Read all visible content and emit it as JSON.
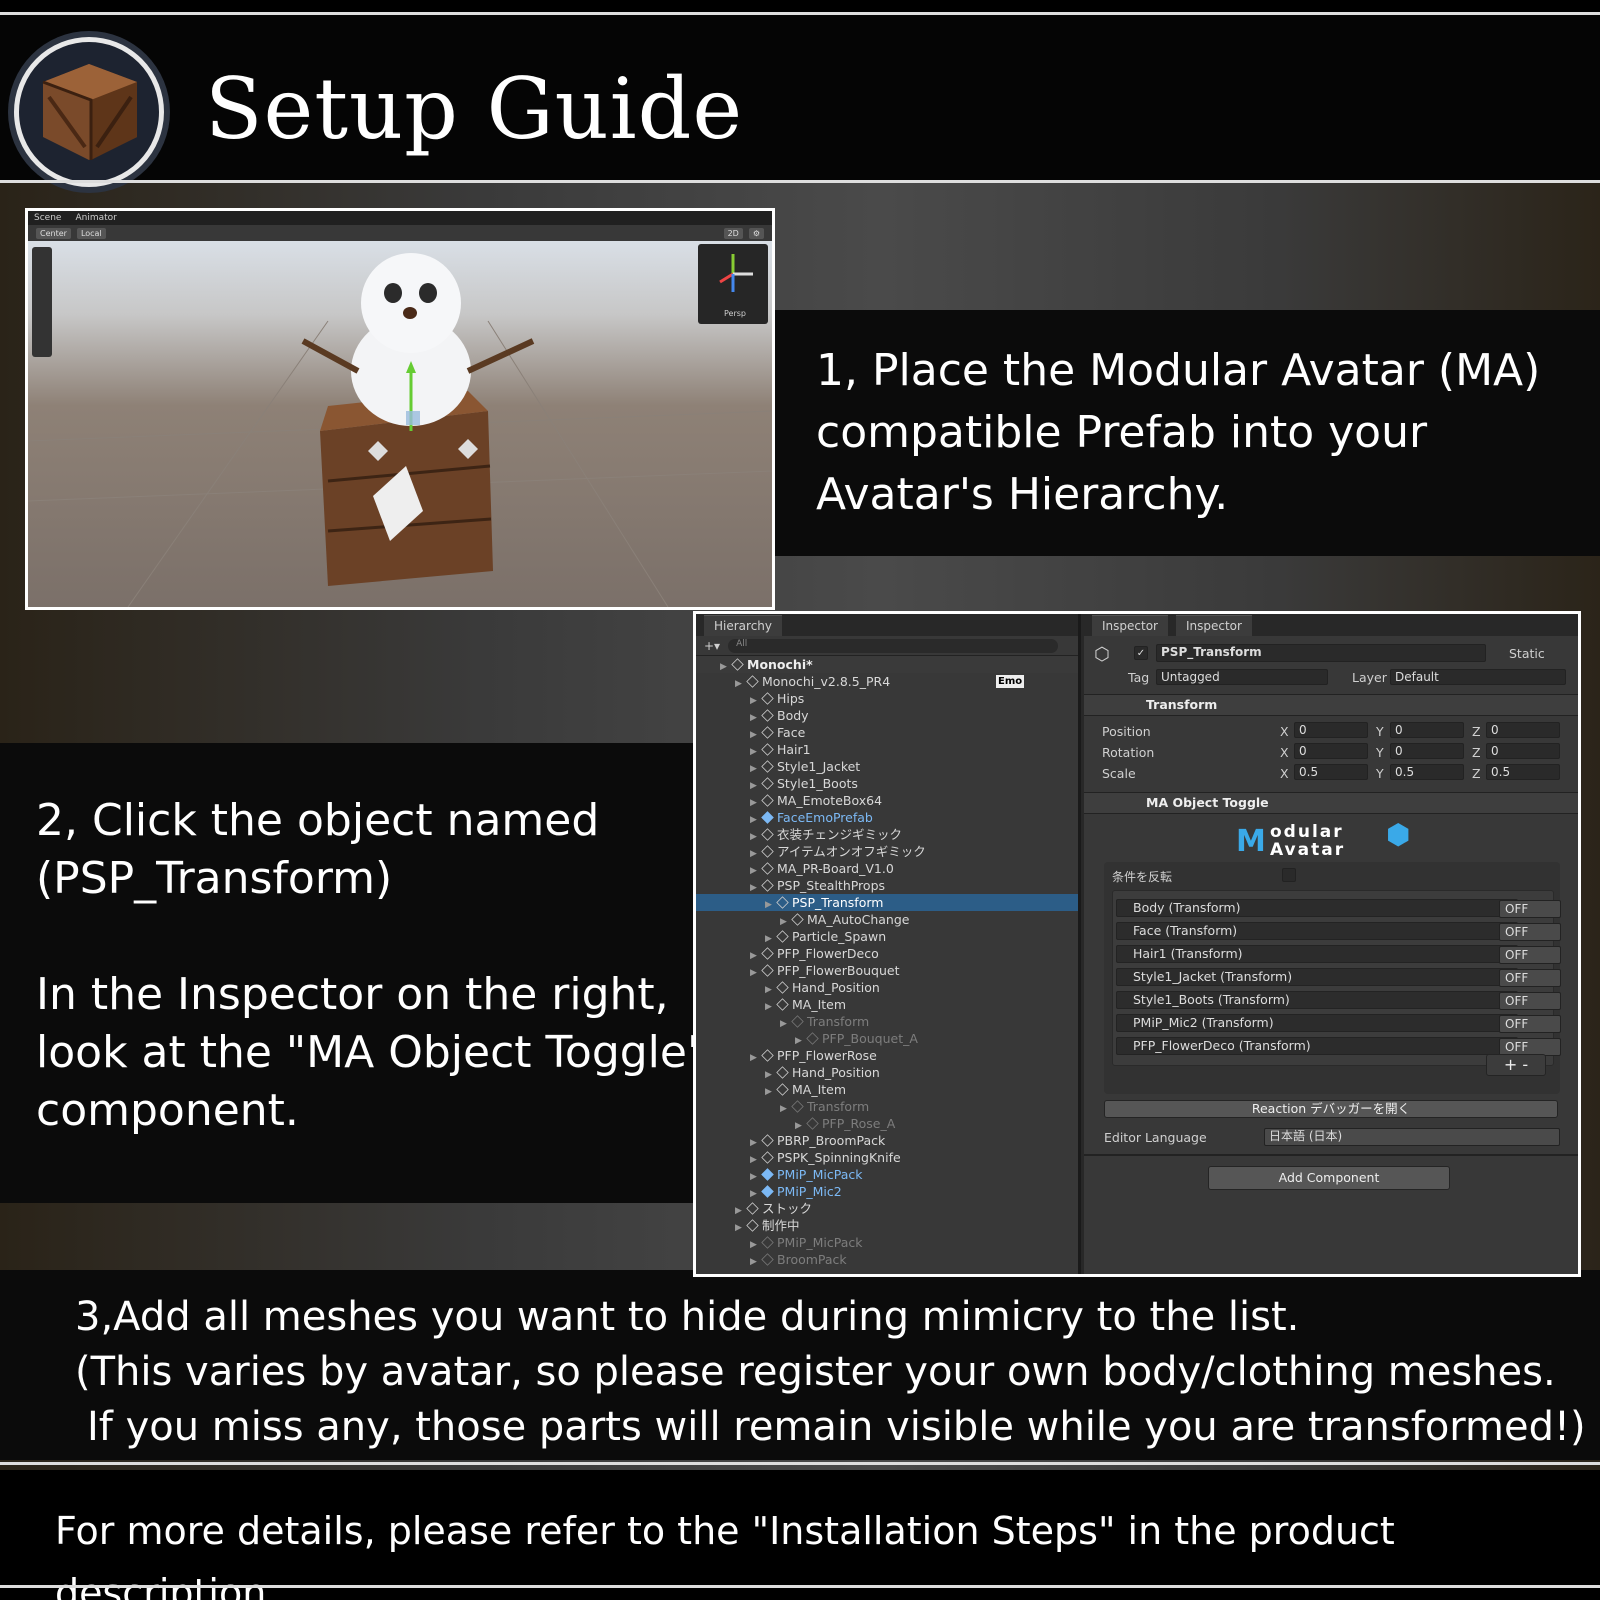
{
  "header": {
    "title": "Setup Guide",
    "logo_icon": "wooden-crate-icon"
  },
  "steps": {
    "step1": [
      "1, Place the Modular Avatar (MA)",
      "compatible Prefab into your",
      "Avatar's Hierarchy."
    ],
    "step2a": [
      "2, Click the object named",
      "(PSP_Transform)"
    ],
    "step2b": [
      "In the Inspector on the right,",
      "look at the \"MA Object Toggle\"",
      "component."
    ],
    "step3": [
      "3,Add all meshes you want to hide during mimicry to the list.",
      "(This varies by avatar, so please register your own body/clothing meshes.",
      "If you miss any, those parts will remain visible while you are transformed!)"
    ]
  },
  "footer": {
    "text": "For more details, please refer to the \"Installation Steps\" in the product description."
  },
  "scene": {
    "tabs": [
      "Scene",
      "Animator"
    ],
    "toolbar": [
      "Center",
      "Local",
      "2D"
    ],
    "persp": "Persp"
  },
  "hierarchy": {
    "title": "Hierarchy",
    "search": "All",
    "emo_badge": "Emo",
    "rows": [
      {
        "t": "Monochi*",
        "i": 2,
        "c": "hdr"
      },
      {
        "t": "Monochi_v2.8.5_PR4",
        "i": 3
      },
      {
        "t": "Hips",
        "i": 4
      },
      {
        "t": "Body",
        "i": 4
      },
      {
        "t": "Face",
        "i": 4
      },
      {
        "t": "Hair1",
        "i": 4
      },
      {
        "t": "Style1_Jacket",
        "i": 4
      },
      {
        "t": "Style1_Boots",
        "i": 4
      },
      {
        "t": "MA_EmoteBox64",
        "i": 4
      },
      {
        "t": "FaceEmoPrefab",
        "i": 4,
        "c": "blue"
      },
      {
        "t": "衣装チェンジギミック",
        "i": 4
      },
      {
        "t": "アイテムオンオフギミック",
        "i": 4
      },
      {
        "t": "MA_PR-Board_V1.0",
        "i": 4
      },
      {
        "t": "PSP_StealthProps",
        "i": 4
      },
      {
        "t": "PSP_Transform",
        "i": 5,
        "c": "sel"
      },
      {
        "t": "MA_AutoChange",
        "i": 6
      },
      {
        "t": "Particle_Spawn",
        "i": 5
      },
      {
        "t": "PFP_FlowerDeco",
        "i": 4
      },
      {
        "t": "PFP_FlowerBouquet",
        "i": 4
      },
      {
        "t": "Hand_Position",
        "i": 5
      },
      {
        "t": "MA_Item",
        "i": 5
      },
      {
        "t": "Transform",
        "i": 6,
        "c": "dim"
      },
      {
        "t": "PFP_Bouquet_A",
        "i": 7,
        "c": "dim"
      },
      {
        "t": "PFP_FlowerRose",
        "i": 4
      },
      {
        "t": "Hand_Position",
        "i": 5
      },
      {
        "t": "MA_Item",
        "i": 5
      },
      {
        "t": "Transform",
        "i": 6,
        "c": "dim"
      },
      {
        "t": "PFP_Rose_A",
        "i": 7,
        "c": "dim"
      },
      {
        "t": "PBRP_BroomPack",
        "i": 4
      },
      {
        "t": "PSPK_SpinningKnife",
        "i": 4
      },
      {
        "t": "PMiP_MicPack",
        "i": 4,
        "c": "blue"
      },
      {
        "t": "PMiP_Mic2",
        "i": 4,
        "c": "blue"
      },
      {
        "t": "ストック",
        "i": 3
      },
      {
        "t": "制作中",
        "i": 3
      },
      {
        "t": "PMiP_MicPack",
        "i": 4,
        "c": "dim"
      },
      {
        "t": "BroomPack",
        "i": 4,
        "c": "dim"
      }
    ]
  },
  "inspector": {
    "tabs": [
      "Inspector",
      "Inspector"
    ],
    "object_name": "PSP_Transform",
    "static": "Static",
    "tag_label": "Tag",
    "tag": "Untagged",
    "layer_label": "Layer",
    "layer": "Default",
    "transform": "Transform",
    "position": "Position",
    "rotation": "Rotation",
    "scale": "Scale",
    "pos": [
      "0",
      "0",
      "0"
    ],
    "rot": [
      "0",
      "0",
      "0"
    ],
    "scl": [
      "0.5",
      "0.5",
      "0.5"
    ],
    "axes": [
      "X",
      "Y",
      "Z"
    ],
    "ma_component": "MA Object Toggle",
    "ma_logo_top": "odular",
    "ma_logo_bottom": "Avatar",
    "invert": "条件を反転",
    "items": [
      "Body (Transform)",
      "Face (Transform)",
      "Hair1 (Transform)",
      "Style1_Jacket (Transform)",
      "Style1_Boots (Transform)",
      "PMiP_Mic2 (Transform)",
      "PFP_FlowerDeco (Transform)"
    ],
    "off": "OFF",
    "plus": "+",
    "minus": "-",
    "reaction": "Reaction デバッガーを開く",
    "lang_label": "Editor Language",
    "lang": "日本語 (日本)",
    "add_component": "Add Component"
  }
}
